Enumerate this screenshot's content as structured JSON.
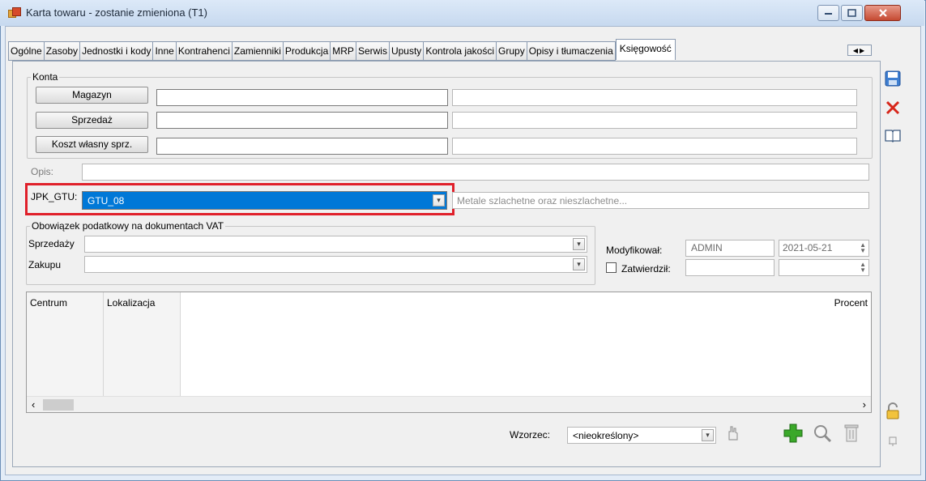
{
  "window": {
    "title": "Karta towaru - zostanie zmieniona (T1)",
    "buttons": {
      "minimize": "–",
      "maximize": "□",
      "close": "✕"
    }
  },
  "tabs": [
    {
      "label": "Ogólne"
    },
    {
      "label": "Zasoby"
    },
    {
      "label": "Jednostki i kody"
    },
    {
      "label": "Inne"
    },
    {
      "label": "Kontrahenci"
    },
    {
      "label": "Zamienniki"
    },
    {
      "label": "Produkcja"
    },
    {
      "label": "MRP"
    },
    {
      "label": "Serwis"
    },
    {
      "label": "Upusty"
    },
    {
      "label": "Kontrola jakości"
    },
    {
      "label": "Grupy"
    },
    {
      "label": "Opisy i tłumaczenia"
    },
    {
      "label": "Księgowość",
      "active": true
    }
  ],
  "konta": {
    "legend": "Konta",
    "rows": [
      {
        "button": "Magazyn",
        "code": "",
        "desc": ""
      },
      {
        "button": "Sprzedaż",
        "code": "",
        "desc": ""
      },
      {
        "button": "Koszt własny sprz.",
        "code": "",
        "desc": ""
      }
    ]
  },
  "opis": {
    "label": "Opis:",
    "value": ""
  },
  "jpk": {
    "label": "JPK_GTU:",
    "value": "GTU_08",
    "description_placeholder": "Metale szlachetne oraz nieszlachetne...",
    "highlight_color": "#e0202a",
    "selection_color": "#0078d7"
  },
  "vat": {
    "legend": "Obowiązek podatkowy na dokumentach VAT",
    "sprzedazy_label": "Sprzedaży",
    "sprzedazy_value": "",
    "zakupu_label": "Zakupu",
    "zakupu_value": ""
  },
  "audit": {
    "modified_label": "Modyfikował:",
    "modified_user": "ADMIN",
    "modified_date": "2021-05-21",
    "approved_label": "Zatwierdził:",
    "approved_checked": false,
    "approved_user": "",
    "approved_date": ""
  },
  "grid": {
    "columns": [
      "Centrum",
      "Lokalizacja",
      "Procent"
    ],
    "rows": []
  },
  "footer": {
    "template_label": "Wzorzec:",
    "template_value": "<nieokreślony>"
  },
  "icons": {
    "save": "save-icon",
    "cancel": "cancel-icon",
    "help": "book-icon",
    "lock": "padlock-icon",
    "pin": "pin-icon",
    "add": "plus-icon",
    "search": "magnifier-icon",
    "delete": "trash-icon",
    "apply": "hand-icon"
  }
}
